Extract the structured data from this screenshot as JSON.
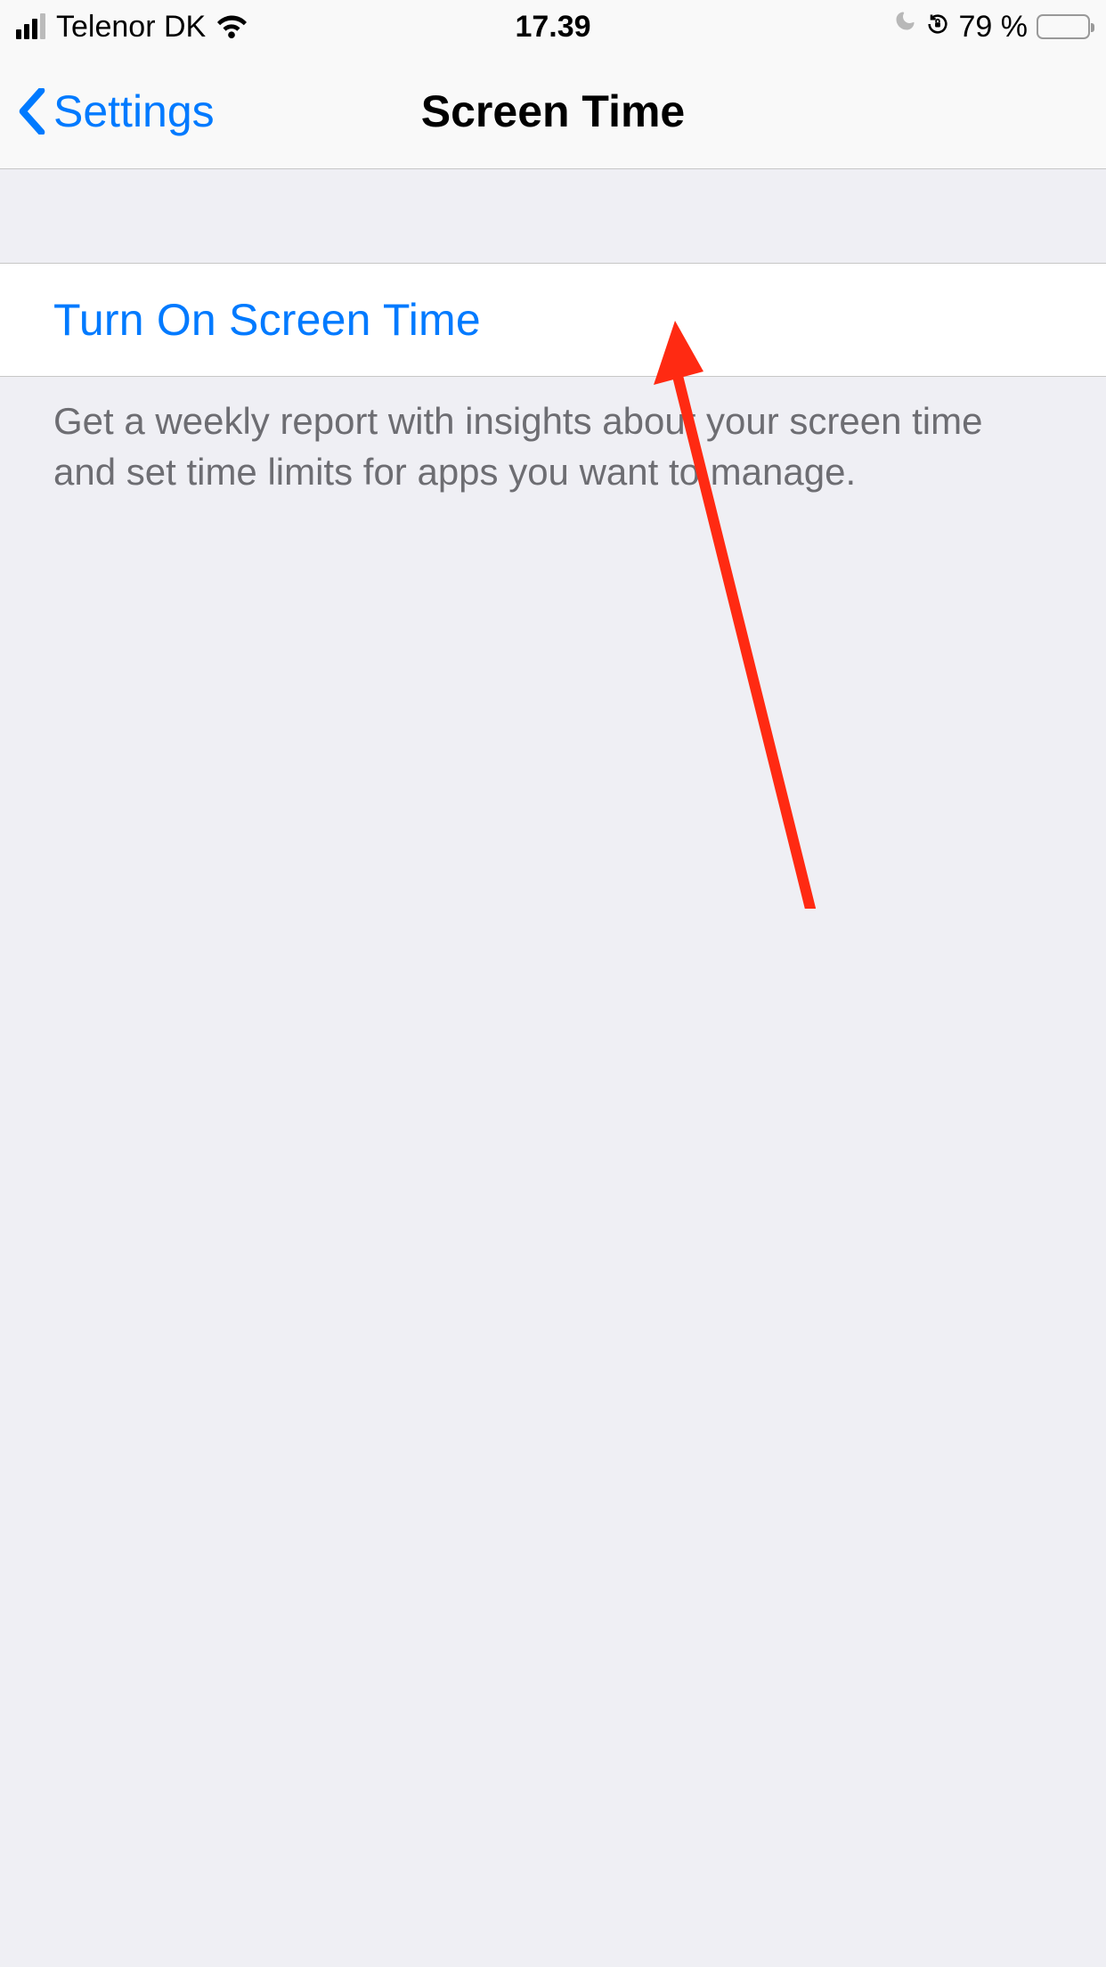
{
  "status_bar": {
    "carrier": "Telenor DK",
    "time": "17.39",
    "battery_percent": "79 %"
  },
  "nav": {
    "back_label": "Settings",
    "title": "Screen Time"
  },
  "main": {
    "action_label": "Turn On Screen Time",
    "description": "Get a weekly report with insights about your screen time and set time limits for apps you want to manage."
  }
}
